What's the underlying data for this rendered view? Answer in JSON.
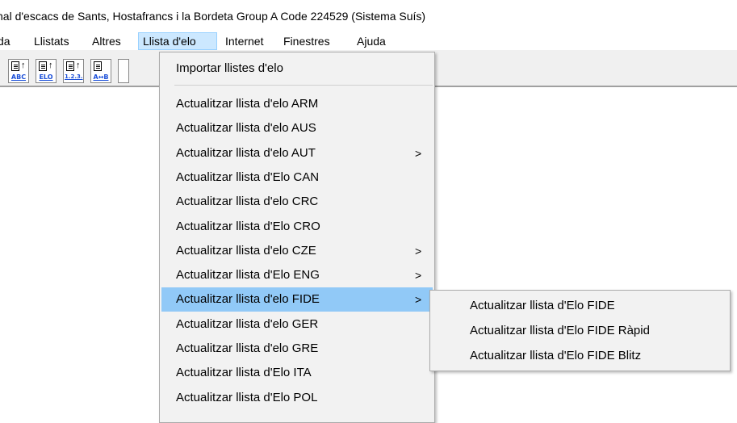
{
  "window": {
    "title": "nal d'escacs de Sants, Hostafrancs i la Bordeta Group A  Code 224529  (Sistema Suís)"
  },
  "menubar": {
    "items": [
      {
        "label": "da"
      },
      {
        "label": "Llistats"
      },
      {
        "label": "Altres"
      },
      {
        "label": "Llista d'elo"
      },
      {
        "label": "Internet"
      },
      {
        "label": "Finestres"
      },
      {
        "label": "Ajuda"
      }
    ]
  },
  "toolbar": {
    "buttons": [
      {
        "icon": "sort-abc-icon",
        "caption": "ABC",
        "arrow": "↑"
      },
      {
        "icon": "sort-elo-icon",
        "caption": "ELO",
        "arrow": "↑"
      },
      {
        "icon": "sort-123-icon",
        "caption": "1.2.3.",
        "arrow": "↑"
      },
      {
        "icon": "sort-a-to-b-icon",
        "caption": "A↔B",
        "arrow": ""
      }
    ]
  },
  "dropdown": {
    "import_label": "Importar llistes d'elo",
    "items": [
      {
        "label": "Actualitzar llista d'elo ARM",
        "submenu": false
      },
      {
        "label": "Actualitzar llista d'elo AUS",
        "submenu": false
      },
      {
        "label": "Actualitzar llista d'elo AUT",
        "submenu": true,
        "chevron": ">"
      },
      {
        "label": "Actualitzar llista d'Elo CAN",
        "submenu": false
      },
      {
        "label": "Actualitzar llista d'elo CRC",
        "submenu": false
      },
      {
        "label": "Actualitzar llista d'Elo CRO",
        "submenu": false
      },
      {
        "label": "Actualitzar llista d'elo CZE",
        "submenu": true,
        "chevron": ">"
      },
      {
        "label": "Actualitzar llista d'Elo ENG",
        "submenu": true,
        "chevron": ">"
      },
      {
        "label": "Actualitzar llista d'elo FIDE",
        "submenu": true,
        "chevron": ">",
        "highlighted": true
      },
      {
        "label": "Actualitzar llista d'elo GER",
        "submenu": false
      },
      {
        "label": "Actualitzar llista d'elo GRE",
        "submenu": false
      },
      {
        "label": "Actualitzar llista d'Elo ITA",
        "submenu": false
      },
      {
        "label": "Actualitzar llista d'Elo POL",
        "submenu": false
      }
    ]
  },
  "submenu": {
    "items": [
      {
        "label": "Actualitzar llista d'Elo FIDE"
      },
      {
        "label": "Actualitzar llista d'Elo FIDE Ràpid"
      },
      {
        "label": "Actualitzar llista d'Elo FIDE Blitz"
      }
    ]
  },
  "colors": {
    "highlight": "#91c9f7",
    "menu_active_bg": "#cce8ff",
    "menu_bg": "#f2f2f2"
  }
}
